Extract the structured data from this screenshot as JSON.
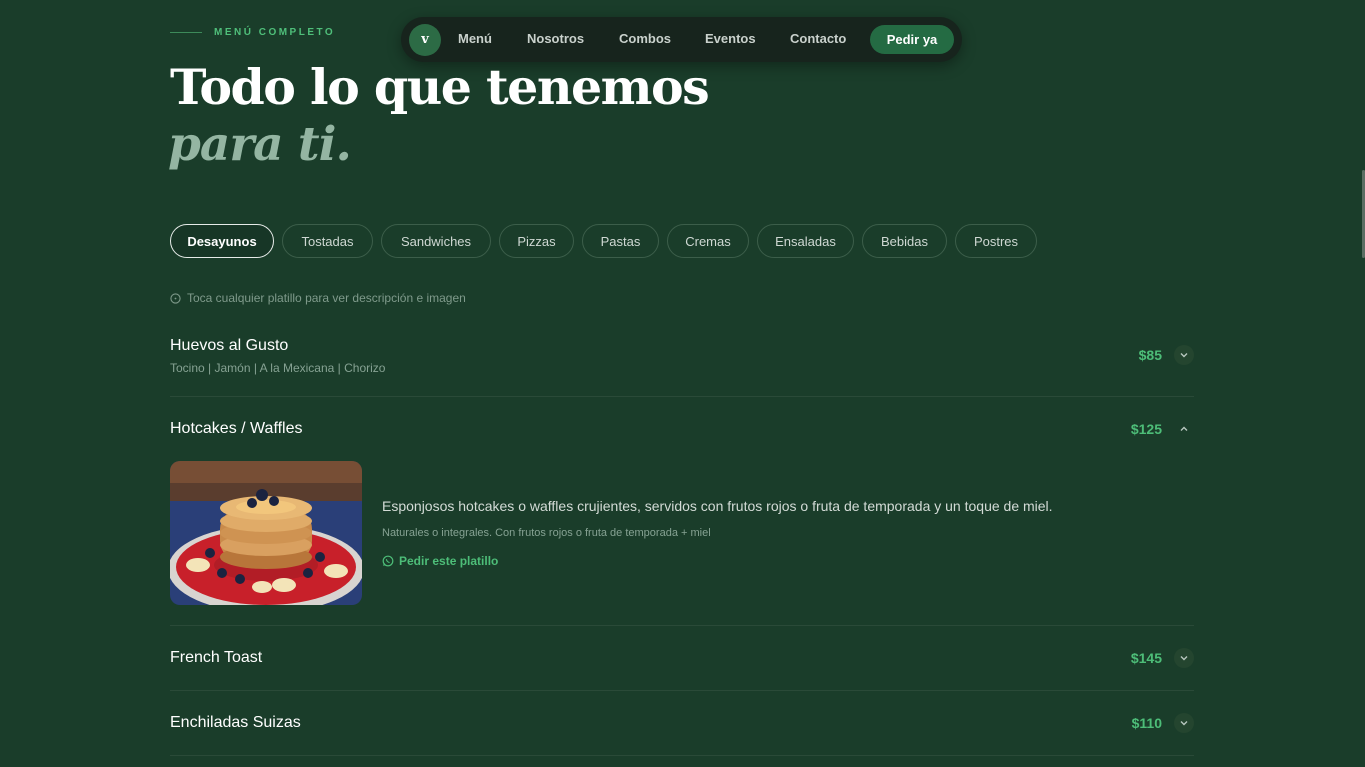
{
  "nav": {
    "logo_letter": "v",
    "links": [
      "Menú",
      "Nosotros",
      "Combos",
      "Eventos",
      "Contacto"
    ],
    "cta": "Pedir ya"
  },
  "header": {
    "eyebrow": "MENÚ COMPLETO",
    "title": "Todo lo que tenemos",
    "subtitle": "para ti."
  },
  "tabs": [
    "Desayunos",
    "Tostadas",
    "Sandwiches",
    "Pizzas",
    "Pastas",
    "Cremas",
    "Ensaladas",
    "Bebidas",
    "Postres"
  ],
  "active_tab": "Desayunos",
  "hint": "Toca cualquier platillo para ver descripción e imagen",
  "items": [
    {
      "name": "Huevos al Gusto",
      "sub": "Tocino | Jamón | A la Mexicana | Chorizo",
      "price": "$85",
      "expanded": false
    },
    {
      "name": "Hotcakes / Waffles",
      "sub": "",
      "price": "$125",
      "expanded": true
    },
    {
      "name": "French Toast",
      "sub": "",
      "price": "$145",
      "expanded": false
    },
    {
      "name": "Enchiladas Suizas",
      "sub": "",
      "price": "$110",
      "expanded": false
    }
  ],
  "expanded_detail": {
    "image_icon": "pancakes-image",
    "description": "Esponjosos hotcakes o waffles crujientes, servidos con frutos rojos o fruta de temporada y un toque de miel.",
    "note": "Naturales o integrales. Con frutos rojos o fruta de temporada + miel",
    "order_label": "Pedir este platillo"
  },
  "colors": {
    "background": "#1a3d2a",
    "accent": "#4dbd78",
    "nav_bg": "#17241d",
    "cta_bg": "#246b43"
  }
}
